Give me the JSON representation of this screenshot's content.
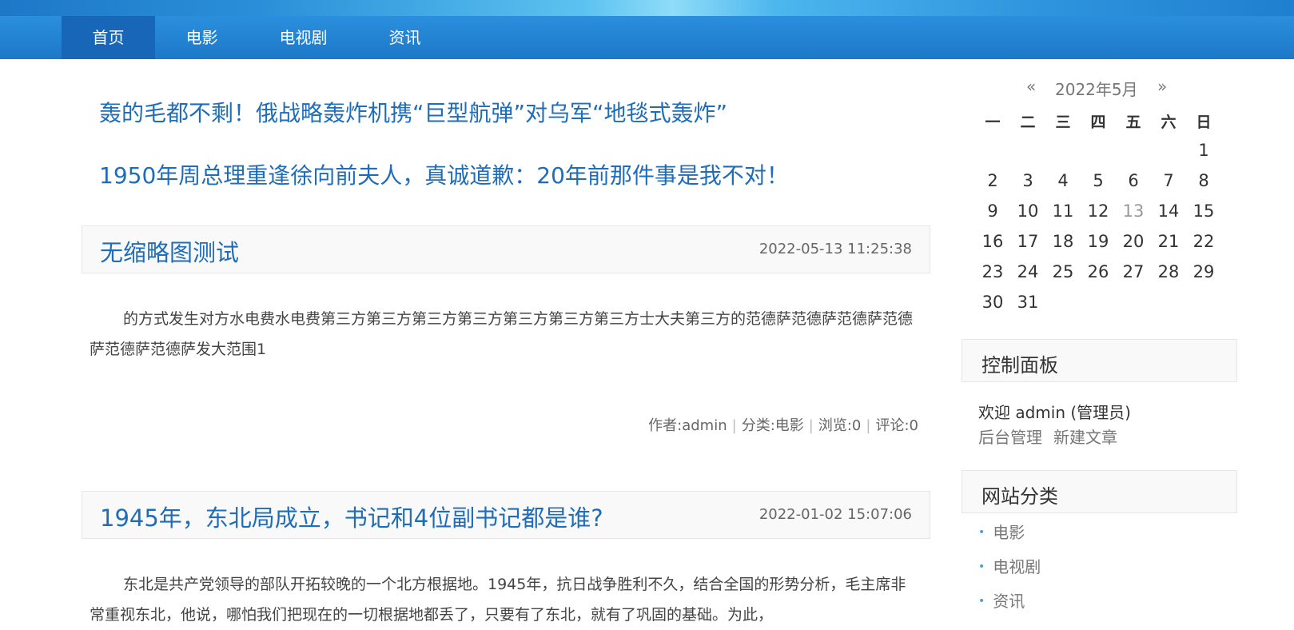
{
  "nav": {
    "items": [
      {
        "label": "首页",
        "active": true
      },
      {
        "label": "电影"
      },
      {
        "label": "电视剧"
      },
      {
        "label": "资讯"
      }
    ]
  },
  "headlines": [
    "轰的毛都不剩！俄战略轰炸机携“巨型航弹”对乌军“地毯式轰炸”",
    "1950年周总理重逢徐向前夫人，真诚道歉：20年前那件事是我不对！"
  ],
  "posts": [
    {
      "title": "无缩略图测试",
      "date": "2022-05-13 11:25:38",
      "body": "的方式发生对方水电费水电费第三方第三方第三方第三方第三方第三方第三方士大夫第三方的范德萨范德萨范德萨范德萨范德萨范德萨发大范围1",
      "author": "作者:admin",
      "category": "分类:电影",
      "views": "浏览:0",
      "comments": "评论:0"
    },
    {
      "title": "1945年，东北局成立，书记和4位副书记都是谁?",
      "date": "2022-01-02 15:07:06",
      "body": "东北是共产党领导的部队开拓较晚的一个北方根据地。1945年，抗日战争胜利不久，结合全国的形势分析，毛主席非常重视东北，他说，哪怕我们把现在的一切根据地都丢了，只要有了东北，就有了巩固的基础。为此，"
    }
  ],
  "calendar": {
    "prev": "«",
    "next": "»",
    "month": "2022年5月",
    "weekdays": [
      "一",
      "二",
      "三",
      "四",
      "五",
      "六",
      "日"
    ],
    "days": [
      "1",
      "2",
      "3",
      "4",
      "5",
      "6",
      "7",
      "8",
      "9",
      "10",
      "11",
      "12",
      "13",
      "14",
      "15",
      "16",
      "17",
      "18",
      "19",
      "20",
      "21",
      "22",
      "23",
      "24",
      "25",
      "26",
      "27",
      "28",
      "29",
      "30",
      "31"
    ],
    "today": "13"
  },
  "control_panel": {
    "title": "控制面板",
    "welcome": "欢迎 admin (管理员)",
    "links": [
      "后台管理",
      "新建文章"
    ]
  },
  "categories": {
    "title": "网站分类",
    "items": [
      "电影",
      "电视剧",
      "资讯"
    ]
  },
  "colors": {
    "nav_bg": "#1d78c8",
    "nav_active": "#1866b8",
    "link_blue": "#1f6db8"
  }
}
